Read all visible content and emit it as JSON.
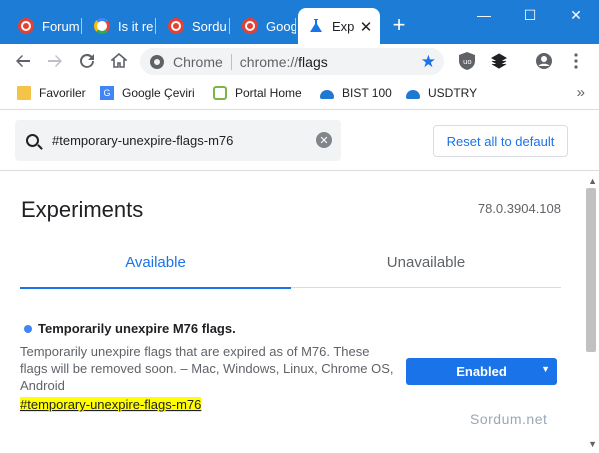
{
  "tabs": [
    {
      "title": "Forum",
      "favicon": "sordum-icon",
      "active": false
    },
    {
      "title": "Is it re",
      "favicon": "google-icon",
      "active": false
    },
    {
      "title": "Sordu",
      "favicon": "sordum-icon",
      "active": false
    },
    {
      "title": "Googl",
      "favicon": "sordum-icon",
      "active": false
    },
    {
      "title": "Exp",
      "favicon": "flask-icon",
      "active": true
    }
  ],
  "window": {
    "minimize": "—",
    "maximize": "☐",
    "close": "✕",
    "new_tab": "+"
  },
  "omnibox": {
    "chip": "Chrome",
    "url_scheme": "chrome://",
    "url_host": "flags"
  },
  "bookmarks": [
    {
      "label": "Favoriler",
      "icon": "folder-icon"
    },
    {
      "label": "Google Çeviri",
      "icon": "google-translate-icon"
    },
    {
      "label": "Portal Home",
      "icon": "portal-icon"
    },
    {
      "label": "BIST 100",
      "icon": "chart-cloud-icon"
    },
    {
      "label": "USDTRY",
      "icon": "chart-cloud-icon"
    }
  ],
  "flags": {
    "search_value": "#temporary-unexpire-flags-m76",
    "reset_label": "Reset all to default",
    "title": "Experiments",
    "version": "78.0.3904.108",
    "tab_available": "Available",
    "tab_unavailable": "Unavailable",
    "experiment": {
      "title": "Temporarily unexpire M76 flags.",
      "description": "Temporarily unexpire flags that are expired as of M76. These flags will be removed soon. – Mac, Windows, Linux, Chrome OS, Android",
      "link": "#temporary-unexpire-flags-m76",
      "state": "Enabled"
    },
    "watermark": "Sordum.net"
  },
  "colors": {
    "titlebar": "#1d7cd5",
    "accent": "#1a73e8",
    "highlight": "#ffff00"
  }
}
